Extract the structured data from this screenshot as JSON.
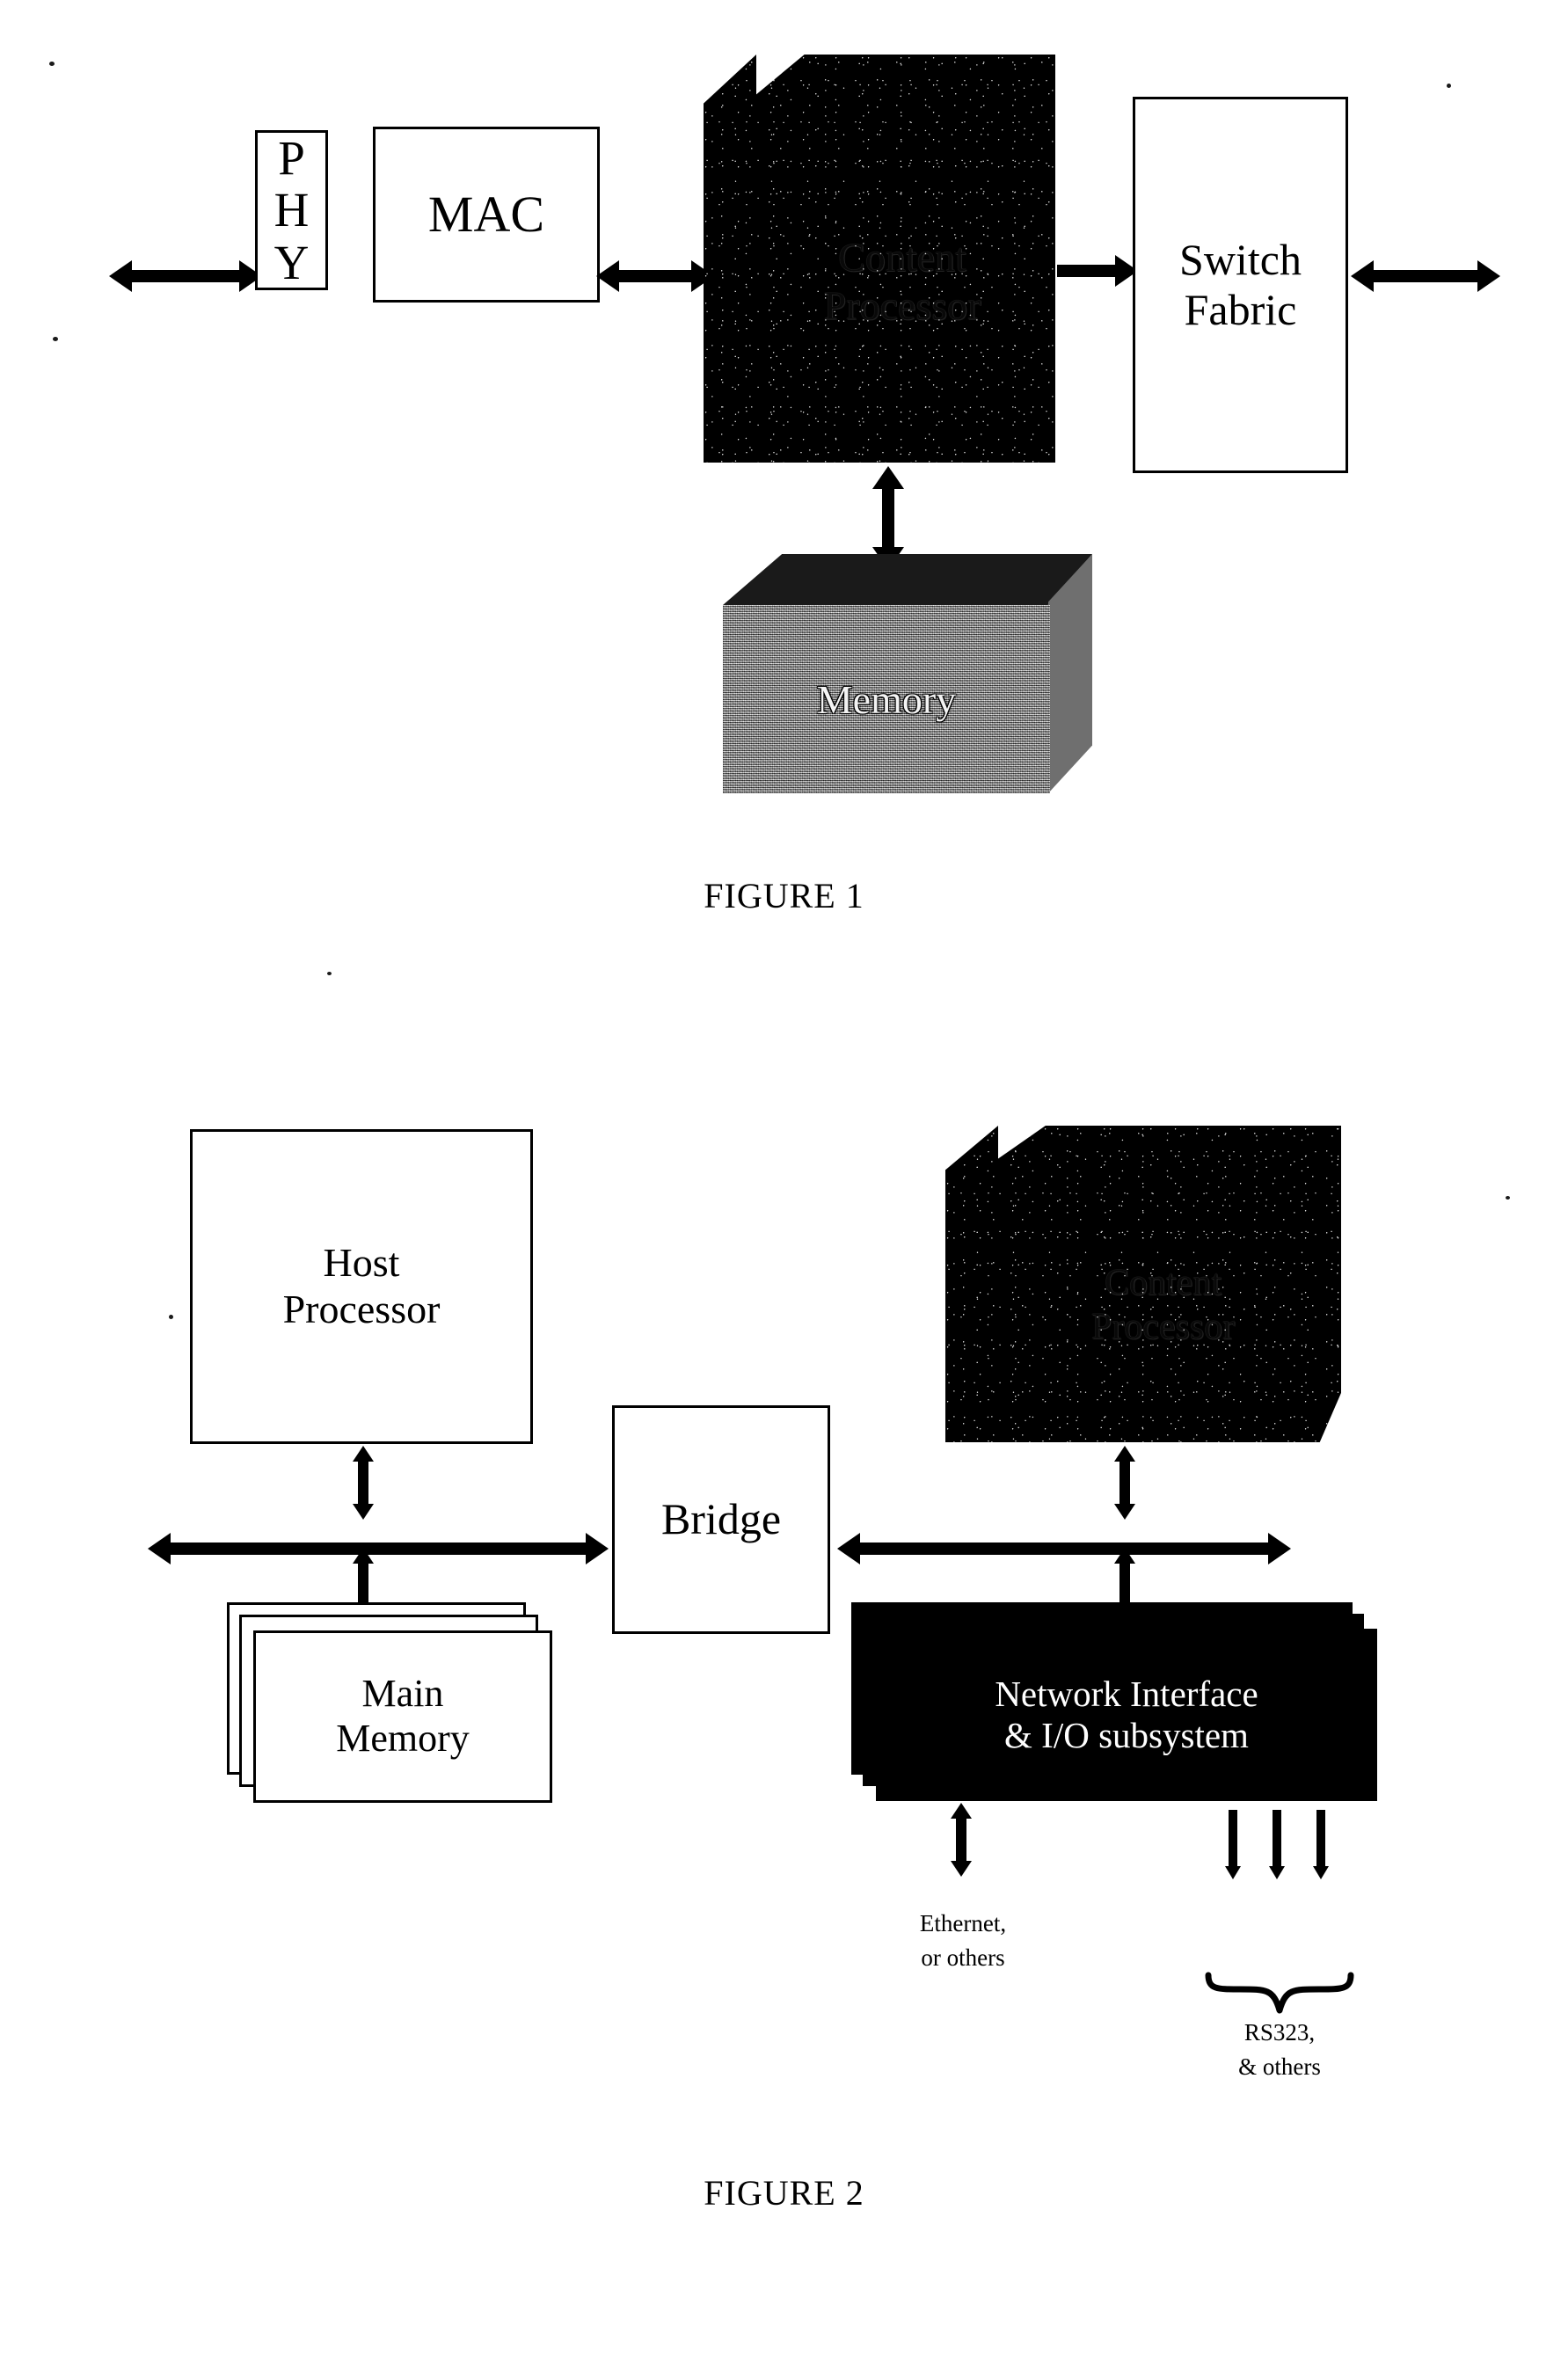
{
  "document": {
    "type": "patent-figure-sheet",
    "background_color": "#ffffff",
    "ink_color": "#000000"
  },
  "figure1": {
    "caption": "FIGURE 1",
    "blocks": {
      "phy": {
        "label": "PHY",
        "letters": [
          "P",
          "H",
          "Y"
        ],
        "style": "outlined-box"
      },
      "mac": {
        "label": "MAC",
        "style": "outlined-box"
      },
      "content_processor": {
        "label": "Content\nProcessor",
        "style": "black-3d-cube"
      },
      "switch_fabric": {
        "label": "Switch\nFabric",
        "style": "outlined-box"
      },
      "memory": {
        "label": "Memory",
        "style": "gray-3d-cube"
      }
    },
    "connections": [
      {
        "from": "external-left",
        "to": "phy",
        "kind": "bidirectional"
      },
      {
        "from": "mac",
        "to": "content_processor",
        "kind": "bidirectional"
      },
      {
        "from": "content_processor",
        "to": "switch_fabric",
        "kind": "unidirectional-right"
      },
      {
        "from": "switch_fabric",
        "to": "external-right",
        "kind": "bidirectional"
      },
      {
        "from": "content_processor",
        "to": "memory",
        "kind": "bidirectional-vertical"
      }
    ]
  },
  "figure2": {
    "caption": "FIGURE 2",
    "blocks": {
      "host_processor": {
        "label": "Host\nProcessor",
        "style": "outlined-box"
      },
      "content_processor": {
        "label": "Content\nProcessor",
        "style": "black-3d-cube"
      },
      "bridge": {
        "label": "Bridge",
        "style": "outlined-box"
      },
      "main_memory": {
        "label": "Main\nMemory",
        "style": "stacked-outlined-box"
      },
      "network_interface": {
        "label": "Network Interface\n& I/O subsystem",
        "style": "stacked-black-box"
      }
    },
    "bus_left": {
      "kind": "bidirectional-bus"
    },
    "bus_right": {
      "kind": "bidirectional-bus"
    },
    "annotations": {
      "ethernet": "Ethernet,\nor others",
      "rs323": "RS323,\n& others"
    },
    "connections": [
      {
        "from": "host_processor",
        "to": "bus_left",
        "kind": "bidirectional-vertical"
      },
      {
        "from": "bus_left",
        "to": "main_memory",
        "kind": "bidirectional-vertical"
      },
      {
        "from": "bus_left",
        "to": "bridge",
        "kind": "unidirectional-right"
      },
      {
        "from": "bridge",
        "to": "bus_right",
        "kind": "unidirectional-left"
      },
      {
        "from": "content_processor",
        "to": "bus_right",
        "kind": "bidirectional-vertical"
      },
      {
        "from": "bus_right",
        "to": "network_interface",
        "kind": "bidirectional-vertical"
      },
      {
        "from": "network_interface",
        "to": "ethernet",
        "kind": "bidirectional-vertical"
      },
      {
        "from": "network_interface",
        "to": "rs323",
        "kind": "unidirectional-down",
        "count": 3
      }
    ]
  }
}
